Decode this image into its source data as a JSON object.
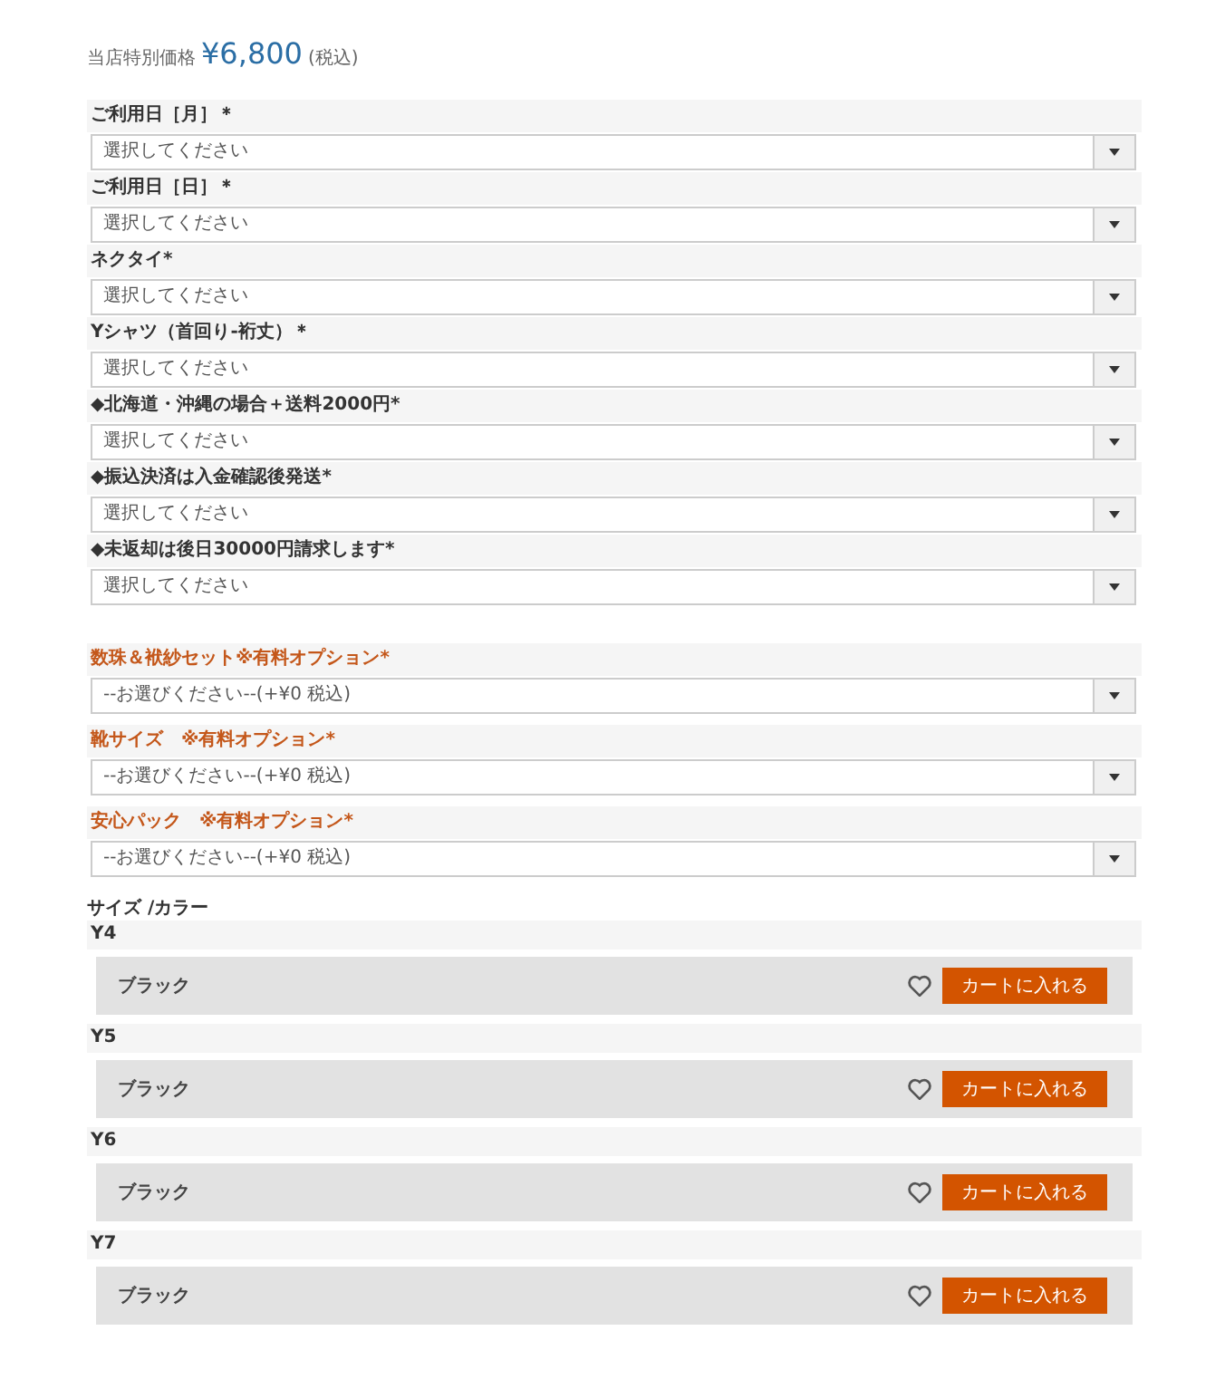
{
  "price": {
    "label": "当店特別価格",
    "amount": "¥6,800",
    "tax": "(税込)"
  },
  "fields": [
    {
      "kind": "required",
      "label": "ご利用日［月］＊",
      "placeholder": "選択してください"
    },
    {
      "kind": "required",
      "label": "ご利用日［日］＊",
      "placeholder": "選択してください"
    },
    {
      "kind": "required",
      "label": "ネクタイ*",
      "placeholder": "選択してください"
    },
    {
      "kind": "required",
      "label": "Yシャツ（首回り-裄丈）＊",
      "placeholder": "選択してください"
    },
    {
      "kind": "required",
      "label": "◆北海道・沖縄の場合＋送料2000円*",
      "placeholder": "選択してください"
    },
    {
      "kind": "required",
      "label": "◆振込決済は入金確認後発送*",
      "placeholder": "選択してください"
    },
    {
      "kind": "required",
      "label": "◆未返却は後日30000円請求します*",
      "placeholder": "選択してください"
    }
  ],
  "options": [
    {
      "kind": "option",
      "label": "数珠＆袱紗セット※有料オプション*",
      "value": "--お選びください--(+¥0 税込)"
    },
    {
      "kind": "option",
      "label": "靴サイズ　※有料オプション*",
      "value": "--お選びください--(+¥0 税込)"
    },
    {
      "kind": "option",
      "label": "安心パック　※有料オプション*",
      "value": "--お選びください--(+¥0 税込)"
    }
  ],
  "variations": {
    "title": "サイズ /カラー",
    "groups": [
      {
        "size": "Y4",
        "color_name": "ブラック",
        "button": "カートに入れる"
      },
      {
        "size": "Y5",
        "color_name": "ブラック",
        "button": "カートに入れる"
      },
      {
        "size": "Y6",
        "color_name": "ブラック",
        "button": "カートに入れる"
      },
      {
        "size": "Y7",
        "color_name": "ブラック",
        "button": "カートに入れる"
      }
    ]
  }
}
